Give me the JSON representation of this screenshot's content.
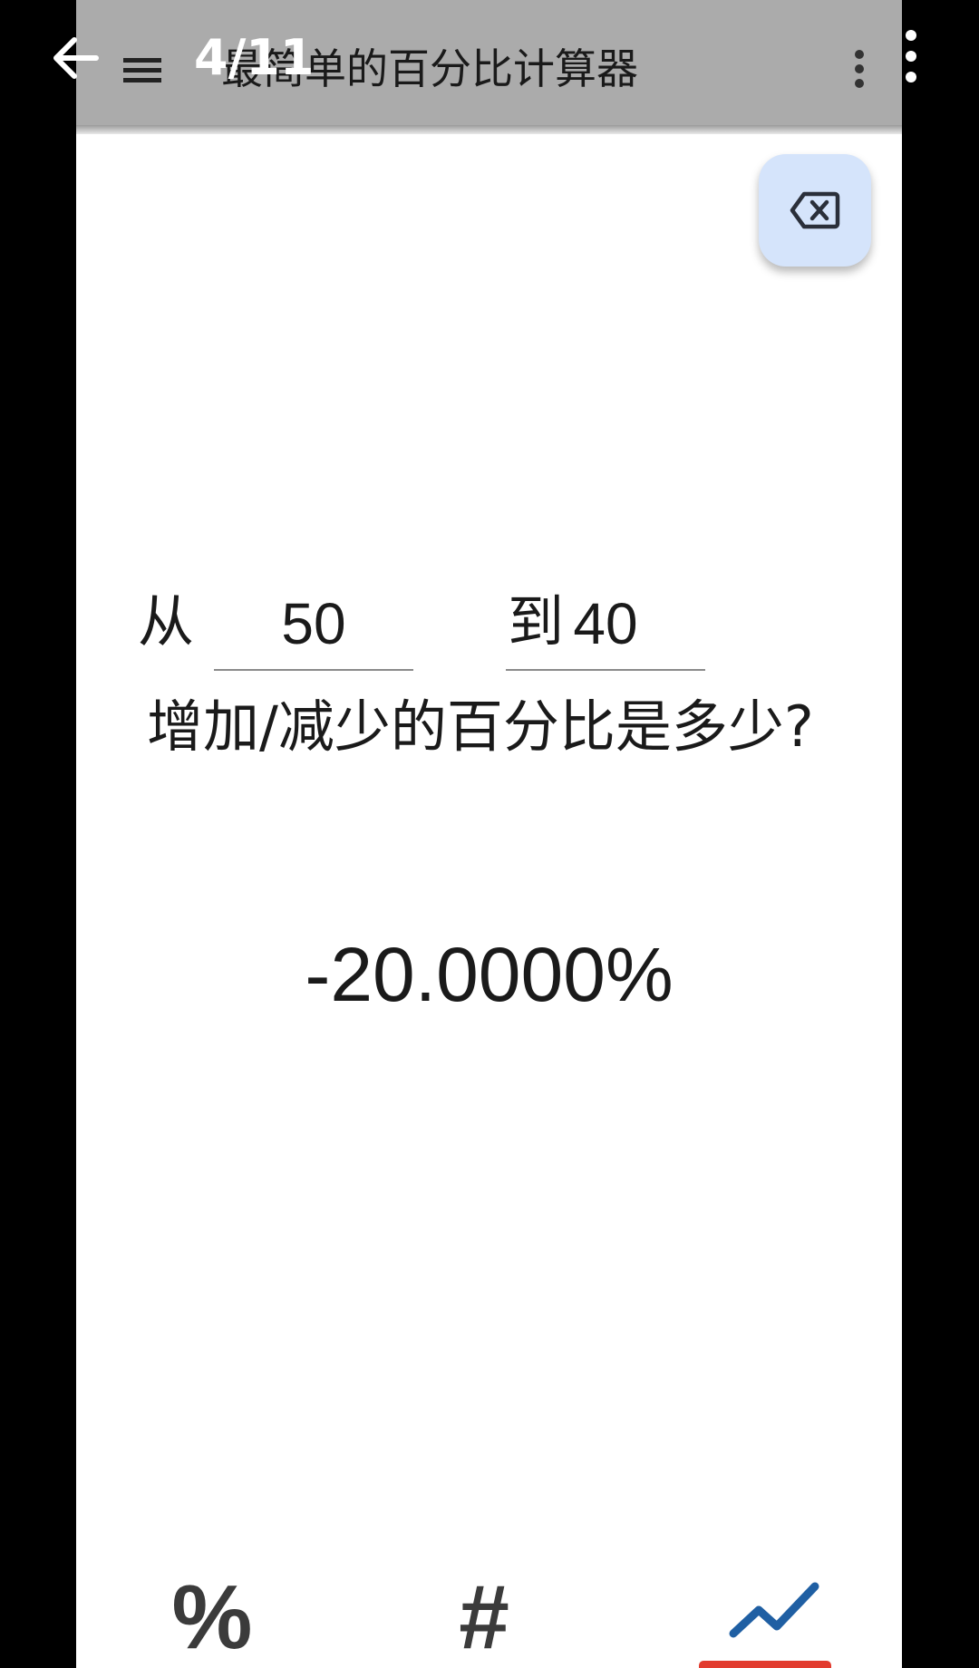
{
  "viewer": {
    "counter": "4/11"
  },
  "appbar": {
    "title": "最简单的百分比计算器"
  },
  "question": {
    "from_label": "从",
    "from_value": "50",
    "to_label": "到",
    "to_value": "40",
    "tail": "增加/减少的百分比是多少?"
  },
  "result": {
    "value": "-20.0000%"
  },
  "bottom_nav": {
    "tabs": [
      {
        "label": "%",
        "icon": "percent-icon"
      },
      {
        "label": "#",
        "icon": "hash-icon"
      },
      {
        "label": "",
        "icon": "trending-up-icon"
      }
    ],
    "selected_index": 2
  },
  "colors": {
    "appbar": "#ababab",
    "fab": "#d5e4fb",
    "accent_blue": "#1f5fa3",
    "indicator_red": "#e23b2e"
  }
}
